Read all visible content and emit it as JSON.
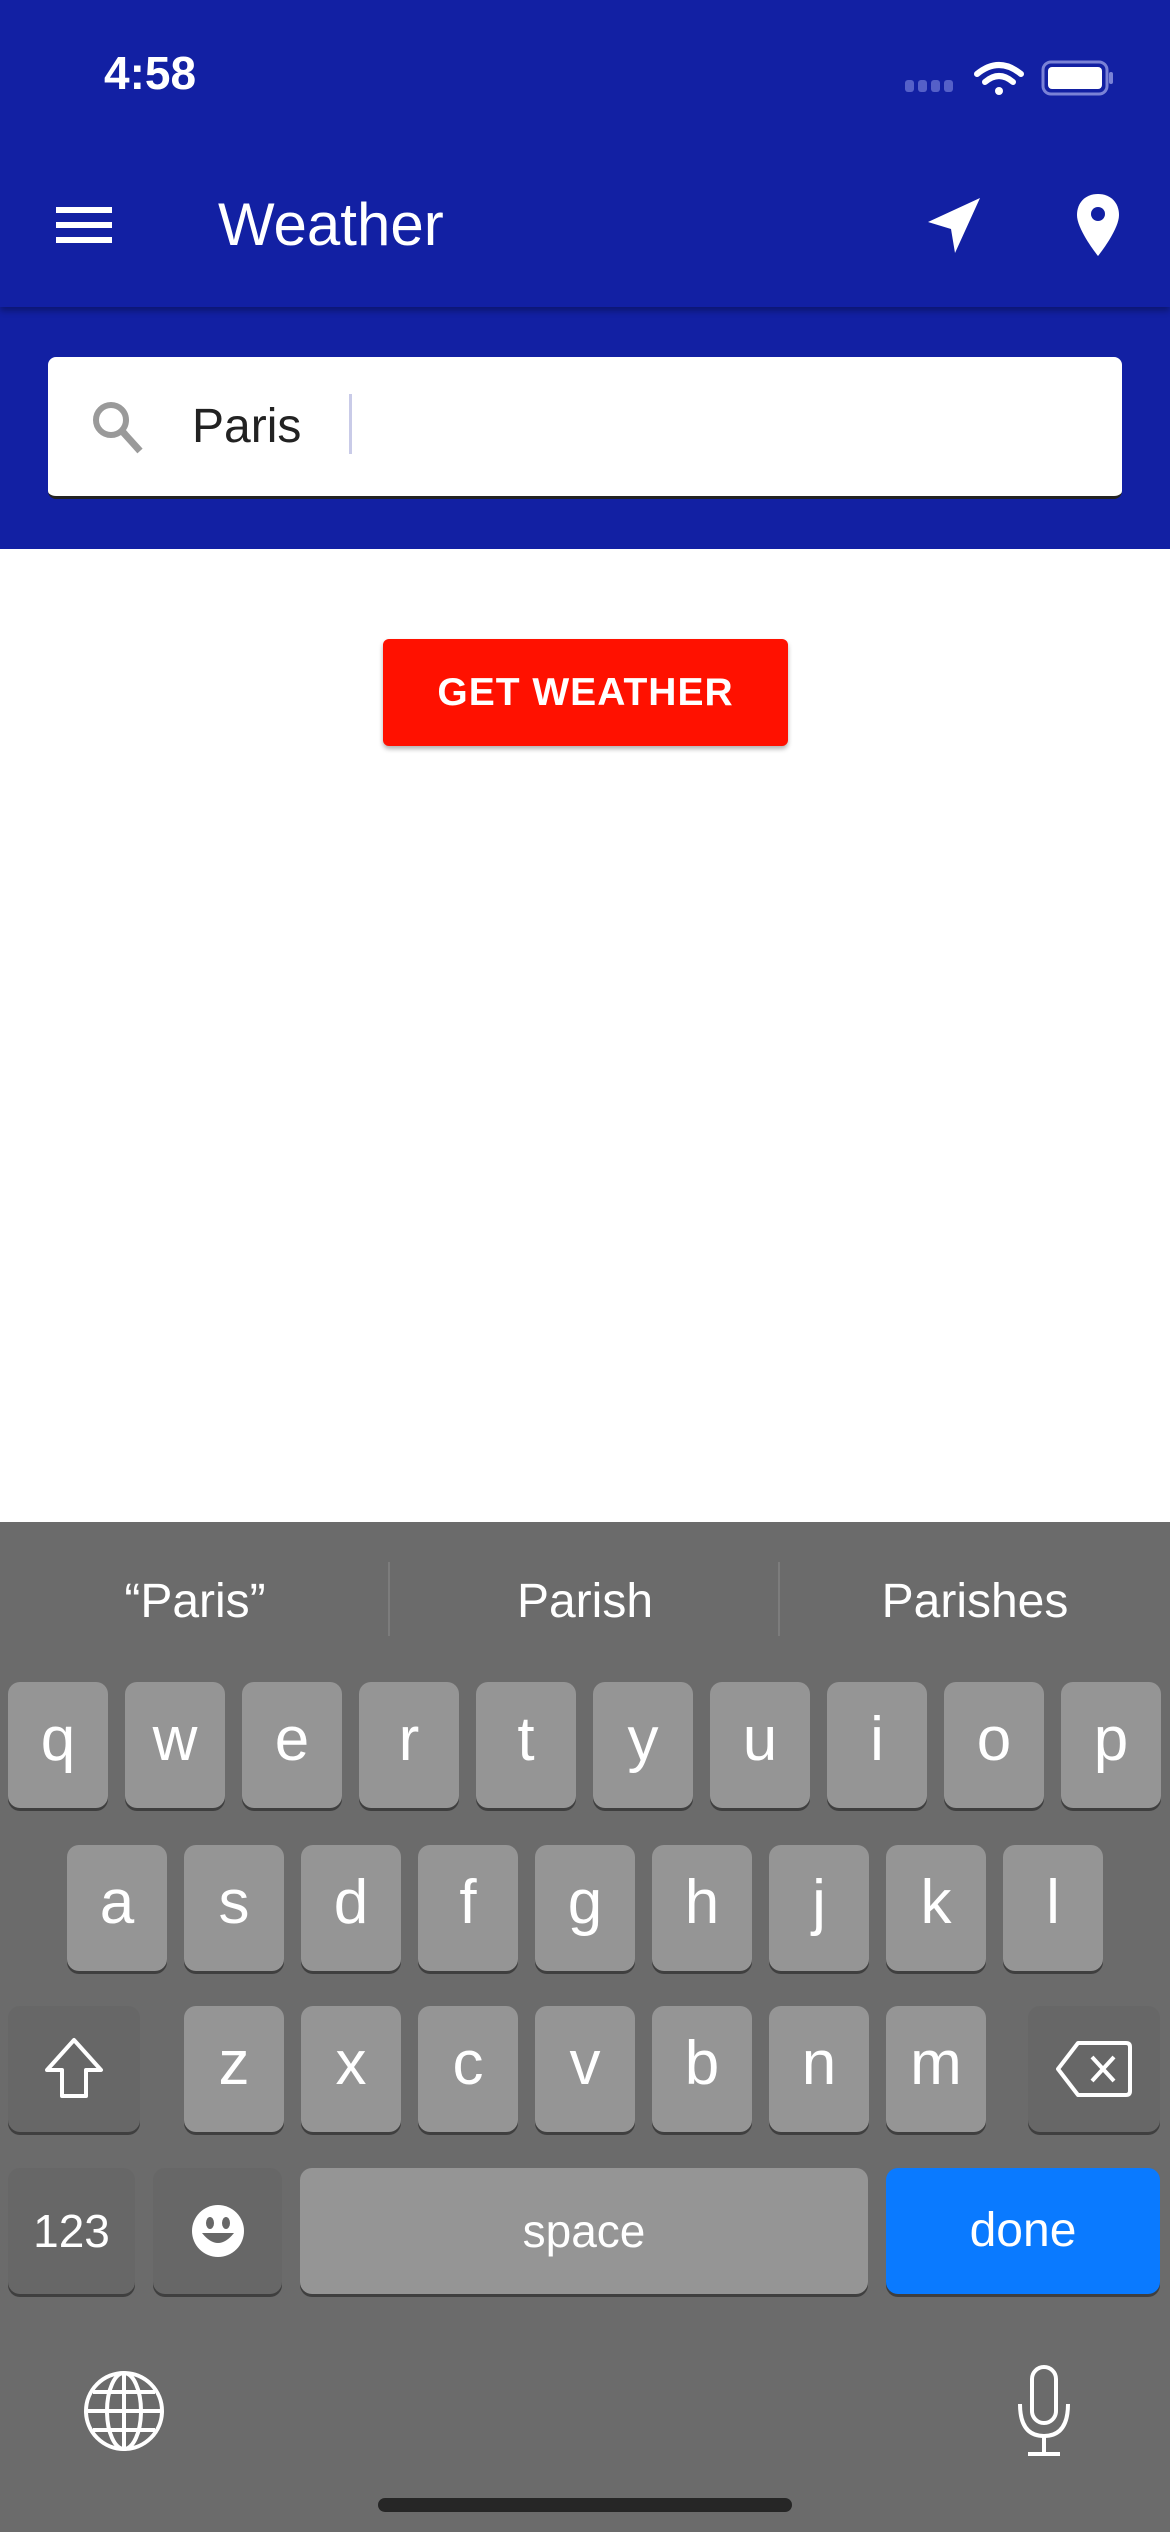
{
  "status_bar": {
    "time": "4:58"
  },
  "app_bar": {
    "title": "Weather",
    "icons": [
      "menu-icon",
      "navigation-arrow-icon",
      "map-pin-icon"
    ]
  },
  "search": {
    "value": "Paris",
    "icon": "search-icon"
  },
  "get_weather_label": "GET WEATHER",
  "colors": {
    "primary": "#1220a3",
    "button": "#ff1100",
    "done": "#0a7aff",
    "keyboard": "#6b6b6b"
  },
  "keyboard": {
    "suggestions": [
      "“Paris”",
      "Parish",
      "Parishes"
    ],
    "row1": [
      "q",
      "w",
      "e",
      "r",
      "t",
      "y",
      "u",
      "i",
      "o",
      "p"
    ],
    "row2": [
      "a",
      "s",
      "d",
      "f",
      "g",
      "h",
      "j",
      "k",
      "l"
    ],
    "row3": [
      "z",
      "x",
      "c",
      "v",
      "b",
      "n",
      "m"
    ],
    "numbers_label": "123",
    "space_label": "space",
    "done_label": "done"
  }
}
